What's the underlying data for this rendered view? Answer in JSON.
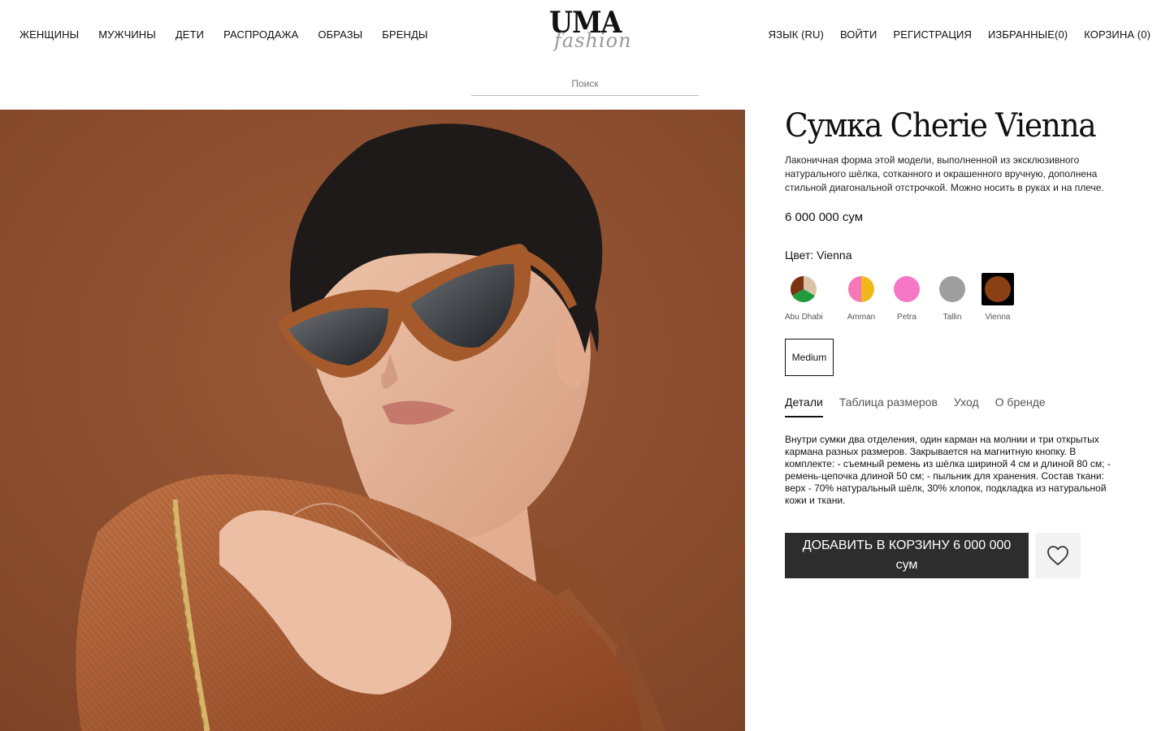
{
  "header": {
    "nav_left": [
      "ЖЕНЩИНЫ",
      "МУЖЧИНЫ",
      "ДЕТИ",
      "РАСПРОДАЖА",
      "ОБРАЗЫ",
      "БРЕНДЫ"
    ],
    "logo": {
      "main": "UMA",
      "sub": "fashion"
    },
    "nav_right": {
      "language": "ЯЗЫК (RU)",
      "login": "ВОЙТИ",
      "register": "РЕГИСТРАЦИЯ",
      "favorites": "ИЗБРАННЫЕ(0)",
      "cart": "КОРЗИНА (0)"
    },
    "search": {
      "placeholder": "Поиск",
      "value": ""
    }
  },
  "product": {
    "title": "Сумка Cherie Vienna",
    "description": "Лаконичная форма этой модели, выполненной из эксклюзивного натурального шёлка, сотканного и окрашенного вручную, дополнена стильной диагональной отстрочкой. Можно носить в руках и на плече.",
    "price": "6 000 000 сум",
    "color_label": "Цвет: Vienna",
    "colors": [
      {
        "name": "Abu Dhabi",
        "colors": [
          "#d9c3a6",
          "#7a3210",
          "#1f9a3c"
        ],
        "selected": false
      },
      {
        "name": "Amman",
        "colors": [
          "#f577b5",
          "#f0b81a"
        ],
        "selected": false
      },
      {
        "name": "Petra",
        "colors": [
          "#f577c6"
        ],
        "selected": false
      },
      {
        "name": "Tallin",
        "colors": [
          "#9e9e9e"
        ],
        "selected": false
      },
      {
        "name": "Vienna",
        "colors": [
          "#8b3f15"
        ],
        "selected": true
      }
    ],
    "size": "Medium",
    "tabs": [
      "Детали",
      "Таблица размеров",
      "Уход",
      "О бренде"
    ],
    "active_tab": "Детали",
    "details_text": "Внутри сумки два отделения, один карман на молнии и три открытых кармана разных размеров. Закрывается на магнитную кнопку. В комплекте: - съемный ремень из шёлка шириной 4 см и длиной 80 см; - ремень-цепочка длиной 50 см; - пыльник для хранения. Состав ткани: верх - 70% натуральный шёлк, 30% хлопок, подкладка из натуральной кожи и ткани.",
    "add_to_cart": "ДОБАВИТЬ В КОРЗИНУ 6 000 000 сум"
  },
  "icons": {
    "favorite": "heart-outline-icon"
  }
}
